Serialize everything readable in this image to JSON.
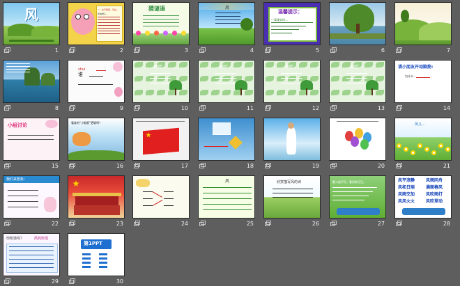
{
  "window": {
    "view": "slide-sorter"
  },
  "slides": [
    {
      "num": "1",
      "kind": "title-wind",
      "texts": [
        "风"
      ]
    },
    {
      "num": "2",
      "kind": "cartoon-note",
      "texts": [
        "一、在字典里，风是...",
        "风的样子..."
      ]
    },
    {
      "num": "3",
      "kind": "garden-note",
      "texts": [
        "猜谜语",
        "..."
      ]
    },
    {
      "num": "4",
      "kind": "sky-poem",
      "texts": [
        "风"
      ]
    },
    {
      "num": "5",
      "kind": "tip-card",
      "texts": [
        "温馨提示：",
        "一读课文时..."
      ]
    },
    {
      "num": "6",
      "kind": "willow",
      "texts": []
    },
    {
      "num": "7",
      "kind": "hills",
      "texts": []
    },
    {
      "num": "8",
      "kind": "lake",
      "texts": []
    },
    {
      "num": "9",
      "kind": "pinyin",
      "texts": [
        "shuí",
        "谁"
      ]
    },
    {
      "num": "10",
      "kind": "leaf-card",
      "texts": [
        "树叶"
      ]
    },
    {
      "num": "11",
      "kind": "leaf-card",
      "texts": [
        "树叶"
      ]
    },
    {
      "num": "12",
      "kind": "leaf-card",
      "texts": [
        "树叶"
      ]
    },
    {
      "num": "13",
      "kind": "leaf-card",
      "texts": [
        "树叶"
      ]
    },
    {
      "num": "14",
      "kind": "think",
      "texts": [
        "请小朋友开动脑筋:",
        "为什么..."
      ]
    },
    {
      "num": "15",
      "kind": "discussion",
      "texts": [
        "小组讨论"
      ]
    },
    {
      "num": "16",
      "kind": "sky-scene",
      "texts": [
        "看谁的“小脑筋”更聪明？"
      ]
    },
    {
      "num": "17",
      "kind": "flag",
      "texts": []
    },
    {
      "num": "18",
      "kind": "kite",
      "texts": []
    },
    {
      "num": "19",
      "kind": "girl",
      "texts": []
    },
    {
      "num": "20",
      "kind": "balloons",
      "texts": []
    },
    {
      "num": "21",
      "kind": "flowers",
      "texts": [
        "风儿..."
      ]
    },
    {
      "num": "22",
      "kind": "fill-blank",
      "texts": [
        "我们来想象："
      ]
    },
    {
      "num": "23",
      "kind": "tiananmen",
      "texts": []
    },
    {
      "num": "24",
      "kind": "match",
      "texts": []
    },
    {
      "num": "25",
      "kind": "lines",
      "texts": [
        "风"
      ]
    },
    {
      "num": "26",
      "kind": "meadow",
      "texts": [
        "欣赏描写风的诗"
      ]
    },
    {
      "num": "27",
      "kind": "poem-green",
      "texts": [
        "野火烧不尽，春风吹又生。"
      ]
    },
    {
      "num": "28",
      "kind": "idioms",
      "texts": [
        "风平浪静",
        "风雨同舟",
        "风和日丽",
        "满面春风",
        "风雨交加",
        "风吹雨打",
        "风风火火",
        "风吹草动"
      ]
    },
    {
      "num": "29",
      "kind": "know",
      "texts": [
        "你知道吗？",
        "风的形成"
      ]
    },
    {
      "num": "30",
      "kind": "ppt-logo",
      "texts": [
        "第1PPT"
      ]
    }
  ]
}
